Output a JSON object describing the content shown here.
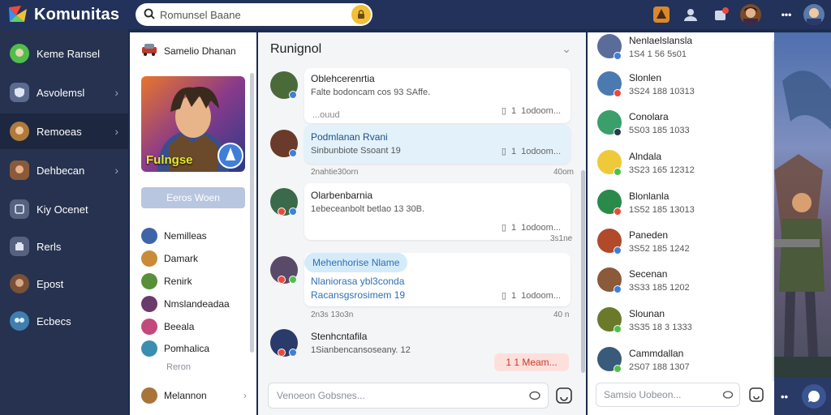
{
  "app": {
    "title": "Komunitas"
  },
  "search": {
    "placeholder": "Romunsel Baane"
  },
  "sidebar": {
    "items": [
      {
        "label": "Keme Ransel",
        "icon": "green-avatar-icon",
        "color": "#4fbf4a"
      },
      {
        "label": "Asvolemsl",
        "icon": "shield-icon",
        "color": "#5b6a8e",
        "chevron": true
      },
      {
        "label": "Remoeas",
        "icon": "avatar-icon",
        "color": "#b07a3b",
        "chevron": true,
        "active": true
      },
      {
        "label": "Dehbecan",
        "icon": "hero-icon",
        "color": "#8a5a3a",
        "chevron": true
      },
      {
        "label": "Kiy Ocenet",
        "icon": "card-icon",
        "color": "#56627f"
      },
      {
        "label": "Rerls",
        "icon": "chest-icon",
        "color": "#56627f"
      },
      {
        "label": "Epost",
        "icon": "warrior-icon",
        "color": "#7a5038"
      },
      {
        "label": "Ecbecs",
        "icon": "group-icon",
        "color": "#3f7fb0"
      }
    ]
  },
  "panel": {
    "header": "Samelio Dhanan",
    "hero_name": "Fulngse",
    "hero_button": "Eeros Woen",
    "friends": [
      {
        "name": "Nemilleas",
        "color": "#3f64a8"
      },
      {
        "name": "Damark",
        "color": "#c98a3a"
      },
      {
        "name": "Renirk",
        "color": "#5a8f3a"
      },
      {
        "name": "Nmslandeadaa",
        "color": "#6a3a6a"
      },
      {
        "name": "Beeala",
        "color": "#c24a7a"
      },
      {
        "name": "Pomhalica",
        "color": "#3a8fb0"
      }
    ],
    "more_label": "Reron",
    "bottom_friend": {
      "name": "Melannon",
      "color": "#a8743a"
    }
  },
  "chat": {
    "title": "Runignol",
    "messages": [
      {
        "name": "Oblehcerenrtia",
        "text": "Falte bodoncam cos 93 SAffe.",
        "small": "...ouud",
        "count": "1",
        "meta": "1odoom..."
      },
      {
        "name": "Podmlanan Rvani",
        "text": "Sinbunbiote Ssoant 19",
        "count": "1",
        "meta": "1odoom...",
        "time_left": "2nahtie30orn",
        "time_right": "40om"
      },
      {
        "name": "Olarbenbarnia",
        "text": "1ebeceanbolt betlao 13 30B.",
        "count": "1",
        "meta": "1odoom...",
        "time_right": "3s1ne"
      },
      {
        "pill": "Mehenhorise Nlame",
        "name": "Nlaniorasa ybl3conda",
        "text": "Racansgsrosimem 19",
        "count": "1",
        "meta": "1odoom...",
        "time_left": "2n3s 13o3n",
        "time_right": "40 n"
      },
      {
        "name": "Stenhcntafila",
        "text": "1Sianbencansoseany. 12",
        "reaction": "1 1 Meam..."
      }
    ],
    "compose_placeholder": "Venoeon Gobsnes..."
  },
  "contacts": {
    "items": [
      {
        "name": "Nenlaelslansla",
        "sub": "1S4 1 56 5s01",
        "color": "#5a6c9a"
      },
      {
        "name": "Slonlen",
        "sub": "3S24 188 10313",
        "color": "#4a7ab0"
      },
      {
        "name": "Conolara",
        "sub": "5S03 185 1033",
        "color": "#3a9f6a"
      },
      {
        "name": "Alndala",
        "sub": "3S23 165 12312",
        "color": "#f0c93a"
      },
      {
        "name": "Blonlanla",
        "sub": "1S52 185 13013",
        "color": "#2a8a4a"
      },
      {
        "name": "Paneden",
        "sub": "3S52 185 1242",
        "color": "#b04a2a"
      },
      {
        "name": "Secenan",
        "sub": "3S33 185 1202",
        "color": "#8a5a3a"
      },
      {
        "name": "Slounan",
        "sub": "3S35 18 3 1333",
        "color": "#6a7a2a"
      },
      {
        "name": "Cammdallan",
        "sub": "2S07 188 1307",
        "color": "#3a5a7a"
      }
    ],
    "compose_placeholder": "Samsio Uobeon..."
  },
  "colors": {
    "topbar": "#22325a",
    "sidebar": "#26324f",
    "accent_yellow": "#f2c037",
    "bubble_blue": "#e3f1fa",
    "reaction_red": "#c73a2c"
  }
}
